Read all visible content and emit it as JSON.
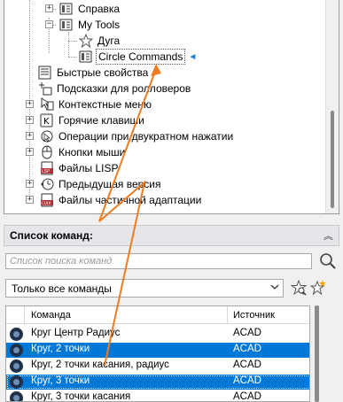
{
  "tree": {
    "items": [
      {
        "label": "Справка",
        "icon": "help-menu-icon"
      },
      {
        "label": "My Tools",
        "icon": "toolbar-icon"
      },
      {
        "label": "Дуга",
        "icon": "star-outline-icon"
      },
      {
        "label": "Circle Commands",
        "icon": "toolbar-icon",
        "selected": true
      },
      {
        "label": "Быстрые свойства",
        "icon": "quick-properties-icon"
      },
      {
        "label": "Подсказки для ролловеров",
        "icon": "rollover-tooltip-icon"
      },
      {
        "label": "Контекстные меню",
        "icon": "context-menu-icon"
      },
      {
        "label": "Горячие клавиши",
        "icon": "keyboard-shortcut-icon"
      },
      {
        "label": "Операции при двукратном нажатии",
        "icon": "double-click-icon"
      },
      {
        "label": "Кнопки мыши",
        "icon": "mouse-buttons-icon"
      },
      {
        "label": "Файлы LISP",
        "icon": "lisp-file-icon"
      },
      {
        "label": "Предыдущая версия",
        "icon": "legacy-icon"
      },
      {
        "label": "Файлы частичной адаптации",
        "icon": "partial-cuix-icon"
      }
    ],
    "marker": "◄"
  },
  "command_list": {
    "title": "Список команд:",
    "collapse_glyph": "︽",
    "search_placeholder": "Список поиска команд",
    "filter_value": "Только все команды",
    "columns": {
      "name": "Команда",
      "source": "Источник"
    },
    "rows": [
      {
        "name": "Круг Центр Радиус",
        "source": "ACAD",
        "selected": false
      },
      {
        "name": "Круг, 2 точки",
        "source": "ACAD",
        "selected": true
      },
      {
        "name": "Круг, 2 точки касания, радиус",
        "source": "ACAD",
        "selected": false
      },
      {
        "name": "Круг, 3 точки",
        "source": "ACAD",
        "selected": true
      },
      {
        "name": "Круг, 3 точки касания",
        "source": "ACAD",
        "selected": false
      }
    ]
  },
  "colors": {
    "selection": "#0078d7",
    "drag_arrow": "#f07c22",
    "marker": "#1e7fd6"
  }
}
